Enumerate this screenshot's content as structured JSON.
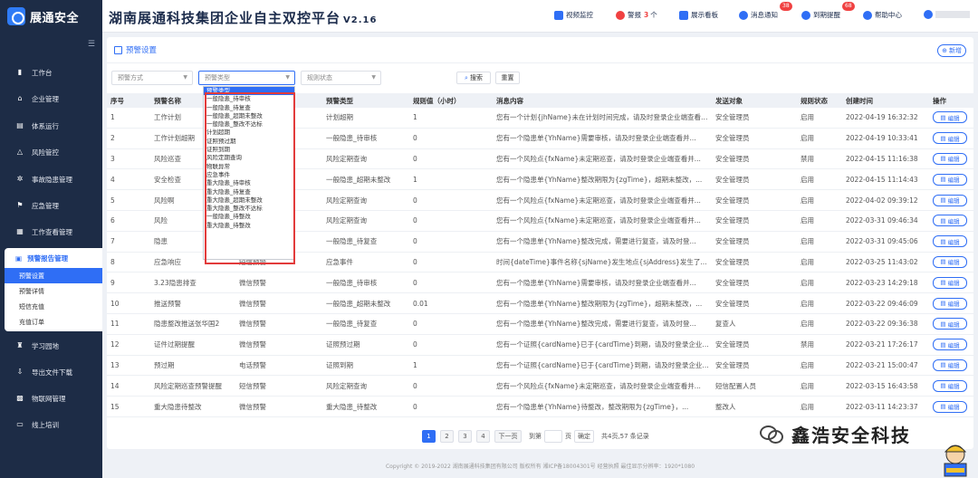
{
  "brand": {
    "name": "展通安全"
  },
  "header": {
    "title": "湖南展通科技集团企业自主双控平台",
    "version": "V2.16",
    "nav": [
      {
        "label": "视频监控",
        "icon": "video-icon",
        "color": "#2f6ef5"
      },
      {
        "label": "警报",
        "count": "3",
        "unit": "个",
        "icon": "alarm-icon",
        "color": "#f04141"
      },
      {
        "label": "展示看板",
        "icon": "dashboard-icon",
        "color": "#2f6ef5"
      },
      {
        "label": "消息通知",
        "badge": "38",
        "icon": "message-icon",
        "color": "#2f6ef5"
      },
      {
        "label": "到期提醒",
        "badge": "68",
        "icon": "clock-icon",
        "color": "#2f6ef5"
      },
      {
        "label": "帮助中心",
        "icon": "help-icon",
        "color": "#2f6ef5"
      }
    ]
  },
  "sidebar": {
    "items": [
      {
        "label": "工作台",
        "icon": "workbench-icon"
      },
      {
        "label": "企业管理",
        "icon": "home-icon"
      },
      {
        "label": "体系运行",
        "icon": "system-icon"
      },
      {
        "label": "风险管控",
        "icon": "risk-icon"
      },
      {
        "label": "事故隐患管理",
        "icon": "hazard-icon"
      },
      {
        "label": "应急管理",
        "icon": "emergency-icon"
      },
      {
        "label": "工作查看管理",
        "icon": "calendar-icon"
      }
    ],
    "active_group": {
      "label": "预警报告管理",
      "subs": [
        "预警设置",
        "预警详情",
        "短信充值",
        "充值订单"
      ]
    },
    "items_after": [
      {
        "label": "学习园地",
        "icon": "study-icon"
      },
      {
        "label": "导出文件下载",
        "icon": "download-icon"
      },
      {
        "label": "物联网管理",
        "icon": "iot-icon"
      },
      {
        "label": "线上培训",
        "icon": "training-icon"
      }
    ]
  },
  "page": {
    "title": "预警设置",
    "add_label": "新增",
    "filters": {
      "method_placeholder": "预警方式",
      "type_placeholder": "预警类型",
      "status_placeholder": "规则状态",
      "search_label": "搜索",
      "reset_label": "重置"
    },
    "dropdown": {
      "selected": "预警类型",
      "options": [
        "一般隐患_待审核",
        "一般隐患_待复查",
        "一般隐患_超期未整改",
        "一般隐患_整改不达标",
        "计划超期",
        "证照预过期",
        "证照到期",
        "风险定期查询",
        "物联异常",
        "应急事件",
        "重大隐患_待审核",
        "重大隐患_待复查",
        "重大隐患_超期未整改",
        "重大隐患_整改不达标",
        "一般隐患_待整改",
        "重大隐患_待整改"
      ]
    }
  },
  "table": {
    "headers": [
      "序号",
      "预警名称",
      "预警方式",
      "预警类型",
      "规则值（小时）",
      "消息内容",
      "发送对象",
      "规则状态",
      "创建时间",
      "操作"
    ],
    "edit_label": "编辑",
    "rows": [
      [
        "1",
        "工作计划",
        "",
        "计划超期",
        "1",
        "您有一个计划{jhName}未在计划时间完成，请及时登录企业端查看并...",
        "安全管理员",
        "启用",
        "2022-04-19 16:32:32"
      ],
      [
        "2",
        "工作计划超期",
        "",
        "一般隐患_待审核",
        "0",
        "您有一个隐患单{YhName}需要审核，请及时登录企业端查看并...",
        "安全管理员",
        "启用",
        "2022-04-19 10:33:41"
      ],
      [
        "3",
        "风险巡查",
        "",
        "风险定期查询",
        "0",
        "您有一个风险点{fxName}未定期巡查，请及时登录企业端查看并...",
        "安全管理员",
        "禁用",
        "2022-04-15 11:16:38"
      ],
      [
        "4",
        "安全检查",
        "",
        "一般隐患_超期未整改",
        "1",
        "您有一个隐患单{YhName}整改期限为{zgTime}，超期未整改，...",
        "安全管理员",
        "启用",
        "2022-04-15 11:14:43"
      ],
      [
        "5",
        "风险啊",
        "",
        "风险定期查询",
        "0",
        "您有一个风险点{fxName}未定期巡查，请及时登录企业端查看并...",
        "安全管理员",
        "启用",
        "2022-04-02 09:39:12"
      ],
      [
        "6",
        "风险",
        "",
        "风险定期查询",
        "0",
        "您有一个风险点{fxName}未定期巡查，请及时登录企业端查看并...",
        "安全管理员",
        "启用",
        "2022-03-31 09:46:34"
      ],
      [
        "7",
        "隐患",
        "",
        "一般隐患_待复查",
        "0",
        "您有一个隐患单{YhName}整改完成，需要进行复查，请及时登...",
        "安全管理员",
        "启用",
        "2022-03-31 09:45:06"
      ],
      [
        "8",
        "应急响应",
        "短信预警",
        "应急事件",
        "0",
        "时间{dateTime}事件名称{sjName}发生地点{sjAddress}发生了...",
        "安全管理员",
        "启用",
        "2022-03-25 11:43:02"
      ],
      [
        "9",
        "3.23隐患排查",
        "微信预警",
        "一般隐患_待审核",
        "0",
        "您有一个隐患单{YhName}需要审核，请及时登录企业端查看并...",
        "安全管理员",
        "启用",
        "2022-03-23 14:29:18"
      ],
      [
        "10",
        "推送预警",
        "微信预警",
        "一般隐患_超期未整改",
        "0.01",
        "您有一个隐患单{YhName}整改期限为{zgTime}，超期未整改，...",
        "安全管理员",
        "启用",
        "2022-03-22 09:46:09"
      ],
      [
        "11",
        "隐患整改推送张华国2",
        "微信预警",
        "一般隐患_待复查",
        "0",
        "您有一个隐患单{YhName}整改完成，需要进行复查，请及时登...",
        "复查人",
        "启用",
        "2022-03-22 09:36:38"
      ],
      [
        "12",
        "证件过期提醒",
        "微信预警",
        "证照预过期",
        "0",
        "您有一个证照{cardName}已于{cardTime}到期，请及时登录企业...",
        "安全管理员",
        "禁用",
        "2022-03-21 17:26:17"
      ],
      [
        "13",
        "预过期",
        "电话预警",
        "证照到期",
        "1",
        "您有一个证照{cardName}已于{cardTime}到期，请及时登录企业...",
        "安全管理员",
        "启用",
        "2022-03-21 15:00:47"
      ],
      [
        "14",
        "风险定期巡查预警提醒",
        "短信预警",
        "风险定期查询",
        "0",
        "您有一个风险点{fxName}未定期巡查，请及时登录企业端查看并...",
        "短信配置人员",
        "启用",
        "2022-03-15 16:43:58"
      ],
      [
        "15",
        "重大隐患待整改",
        "微信预警",
        "重大隐患_待整改",
        "0",
        "您有一个隐患单{YhName}待整改，整改期限为{zgTime}，...",
        "整改人",
        "启用",
        "2022-03-11 14:23:37"
      ]
    ]
  },
  "pager": {
    "pages": [
      "1",
      "2",
      "3",
      "4"
    ],
    "current": "1",
    "next_label": "下一页",
    "goto_label": "到第",
    "page_unit": "页",
    "confirm_label": "确定",
    "summary": "共4页,57 条记录"
  },
  "footer": {
    "text": "Copyright © 2019-2022 湖南展通科技集团有限公司 版权所有 湘ICP备18004301号 经营执照   最佳显示分辨率：1920*1080"
  },
  "watermark": {
    "text": "鑫浩安全科技"
  }
}
